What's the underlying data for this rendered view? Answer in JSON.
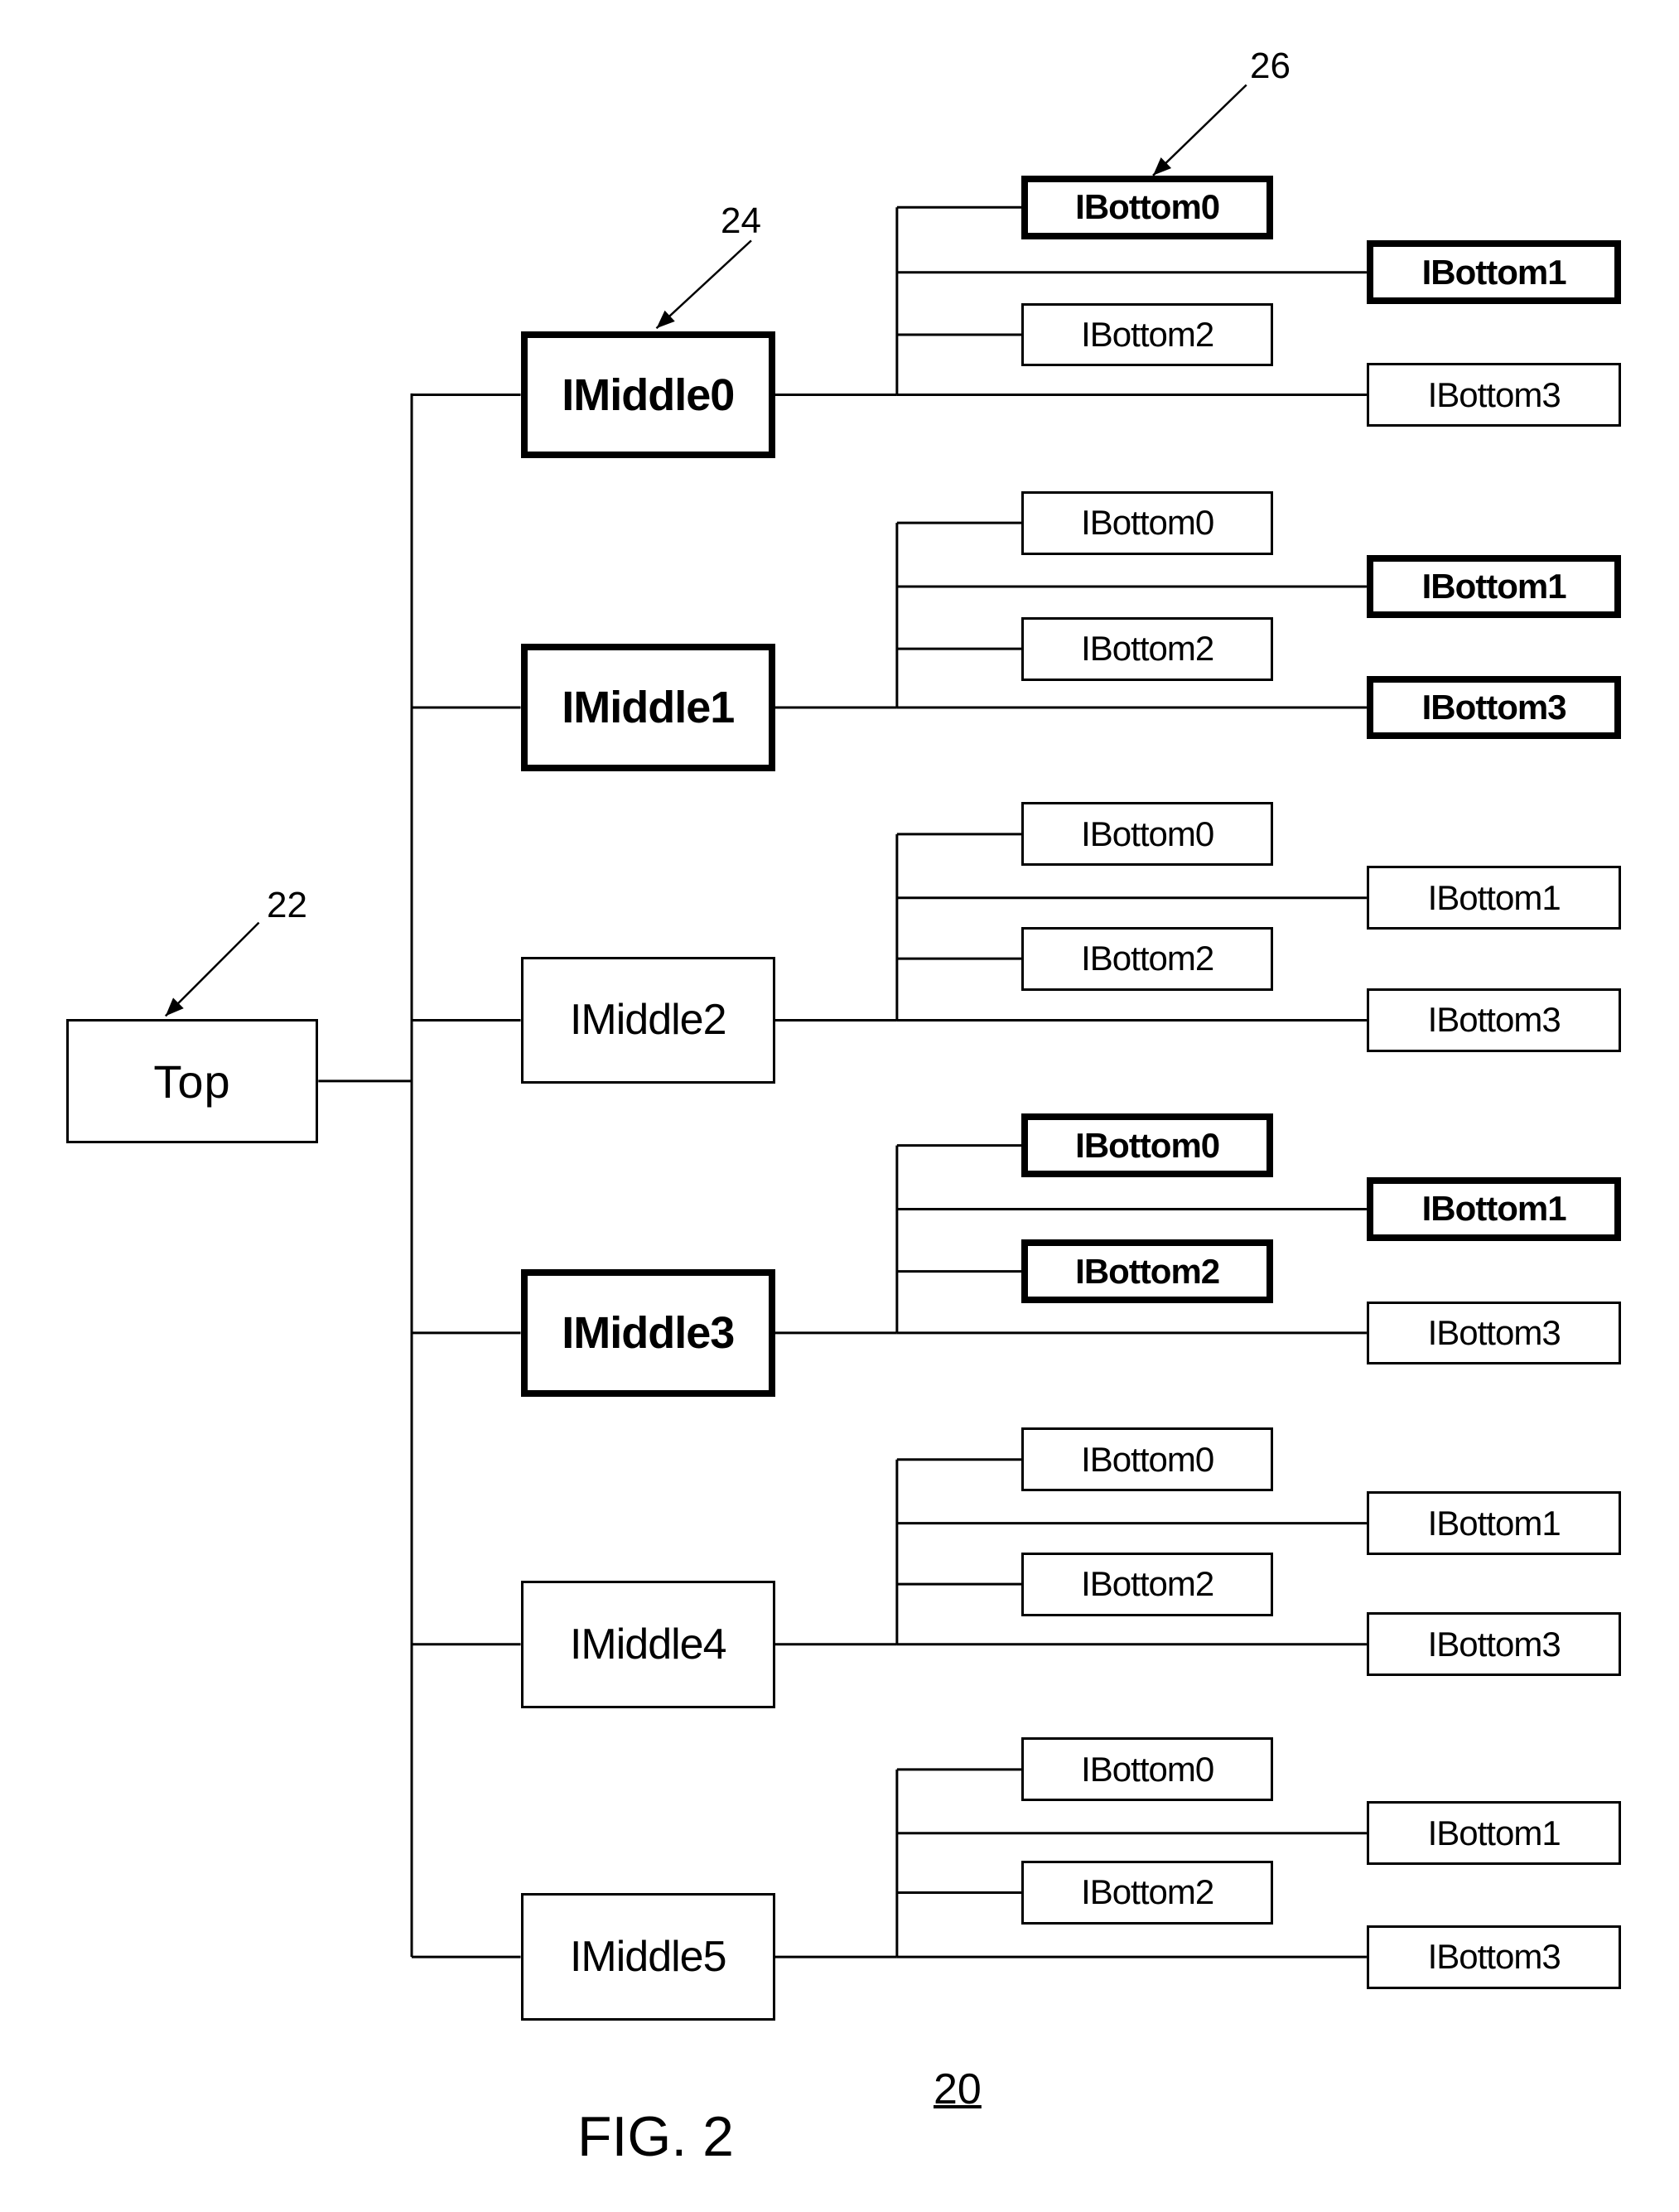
{
  "figure": {
    "caption": "FIG. 2",
    "number": "20",
    "refs": {
      "top": "22",
      "middle": "24",
      "bottom": "26"
    }
  },
  "top": {
    "label": "Top",
    "highlighted": false
  },
  "middles": [
    {
      "label": "IMiddle0",
      "highlighted": true,
      "bottoms": [
        {
          "label": "IBottom0",
          "highlighted": true
        },
        {
          "label": "IBottom1",
          "highlighted": true
        },
        {
          "label": "IBottom2",
          "highlighted": false
        },
        {
          "label": "IBottom3",
          "highlighted": false
        }
      ]
    },
    {
      "label": "IMiddle1",
      "highlighted": true,
      "bottoms": [
        {
          "label": "IBottom0",
          "highlighted": false
        },
        {
          "label": "IBottom1",
          "highlighted": true
        },
        {
          "label": "IBottom2",
          "highlighted": false
        },
        {
          "label": "IBottom3",
          "highlighted": true
        }
      ]
    },
    {
      "label": "IMiddle2",
      "highlighted": false,
      "bottoms": [
        {
          "label": "IBottom0",
          "highlighted": false
        },
        {
          "label": "IBottom1",
          "highlighted": false
        },
        {
          "label": "IBottom2",
          "highlighted": false
        },
        {
          "label": "IBottom3",
          "highlighted": false
        }
      ]
    },
    {
      "label": "IMiddle3",
      "highlighted": true,
      "bottoms": [
        {
          "label": "IBottom0",
          "highlighted": true
        },
        {
          "label": "IBottom1",
          "highlighted": true
        },
        {
          "label": "IBottom2",
          "highlighted": true
        },
        {
          "label": "IBottom3",
          "highlighted": false
        }
      ]
    },
    {
      "label": "IMiddle4",
      "highlighted": false,
      "bottoms": [
        {
          "label": "IBottom0",
          "highlighted": false
        },
        {
          "label": "IBottom1",
          "highlighted": false
        },
        {
          "label": "IBottom2",
          "highlighted": false
        },
        {
          "label": "IBottom3",
          "highlighted": false
        }
      ]
    },
    {
      "label": "IMiddle5",
      "highlighted": false,
      "bottoms": [
        {
          "label": "IBottom0",
          "highlighted": false
        },
        {
          "label": "IBottom1",
          "highlighted": false
        },
        {
          "label": "IBottom2",
          "highlighted": false
        },
        {
          "label": "IBottom3",
          "highlighted": false
        }
      ]
    }
  ]
}
